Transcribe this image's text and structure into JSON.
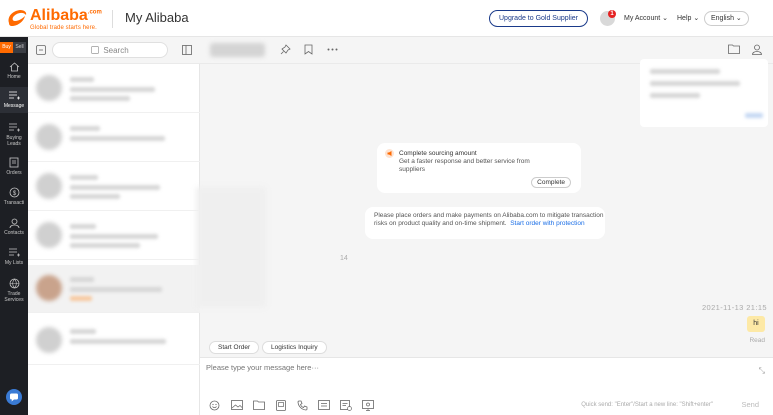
{
  "header": {
    "logo_name": "Alibaba",
    "logo_suffix": ".com",
    "logo_tagline": "Global trade starts here.",
    "page_title": "My Alibaba",
    "upgrade_label": "Upgrade to Gold Supplier",
    "notification_count": "1",
    "account_label": "My Account",
    "help_label": "Help",
    "language_label": "English"
  },
  "nav": {
    "buy_label": "Buy",
    "sell_label": "Sell",
    "items": [
      {
        "label": "Home",
        "icon": "home-icon"
      },
      {
        "label": "Message",
        "icon": "message-icon"
      },
      {
        "label": "Buying Leads",
        "icon": "buying-leads-icon"
      },
      {
        "label": "Orders",
        "icon": "orders-icon"
      },
      {
        "label": "Transacti",
        "icon": "transactions-icon"
      },
      {
        "label": "Contacts",
        "icon": "contacts-icon"
      },
      {
        "label": "My Lists",
        "icon": "my-lists-icon"
      },
      {
        "label": "Trade Services",
        "icon": "trade-services-icon"
      }
    ]
  },
  "conversations": {
    "search_placeholder": "Search"
  },
  "chat": {
    "sourcing_card": {
      "title": "Complete sourcing amount",
      "description": "Get a faster response and better service from suppliers",
      "button_label": "Complete"
    },
    "payment_notice": {
      "text": "Please place orders and make payments on Alibaba.com to mitigate transaction risks on product quality and on-time shipment.",
      "link": "Start order with protection"
    },
    "unread_count": "14",
    "timestamp": "2021-11-13 21:15",
    "message": "hi",
    "read_status": "Read",
    "quick_actions": [
      "Start Order",
      "Logistics Inquiry"
    ],
    "composer_placeholder": "Please type your message here···",
    "composer_hint": "Quick send: \"Enter\"/Start a new line: \"Shift+enter\"",
    "send_label": "Send"
  },
  "colors": {
    "brand": "#ff6a00",
    "nav_bg": "#1d1f24",
    "link": "#1a6ee6",
    "bubble": "#fde9a6"
  }
}
